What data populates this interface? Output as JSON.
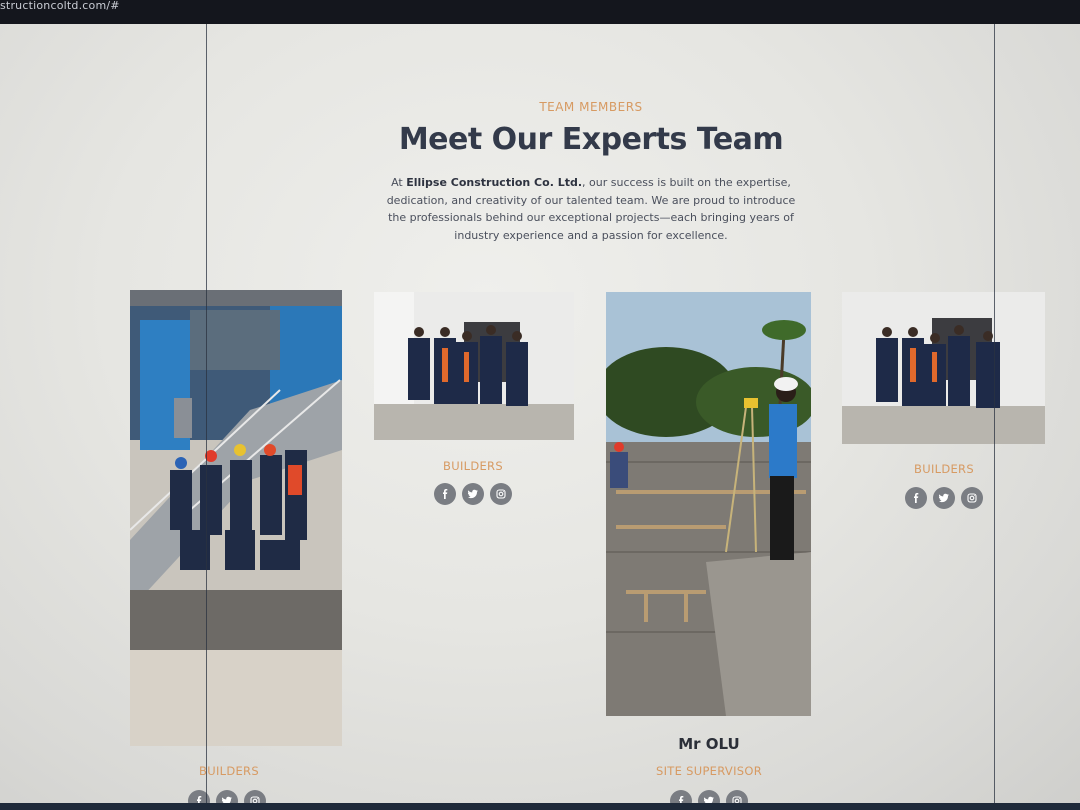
{
  "browser": {
    "url": "structioncoltd.com/#"
  },
  "section": {
    "kicker": "TEAM MEMBERS",
    "title": "Meet Our Experts Team",
    "desc_prefix": "At ",
    "company": "Ellipse Construction Co. Ltd.",
    "desc_suffix": ", our success is built on the expertise, dedication, and creativity of our talented team. We are proud to introduce the professionals behind our exceptional projects—each bringing years of industry experience and a passion for excellence."
  },
  "team": [
    {
      "role": "BUILDERS",
      "photo": "group-at-building-stairs"
    },
    {
      "role": "BUILDERS",
      "photo": "group-in-office"
    },
    {
      "name": "Mr OLU",
      "role": "SITE SUPERVISOR",
      "photo": "surveyor-on-site"
    },
    {
      "role": "BUILDERS",
      "photo": "group-in-office"
    }
  ],
  "social_icons": [
    "facebook-icon",
    "twitter-icon",
    "instagram-icon"
  ],
  "colors": {
    "accent": "#d79a62",
    "heading": "#333a4a",
    "icon_bg": "#7a7d83"
  }
}
